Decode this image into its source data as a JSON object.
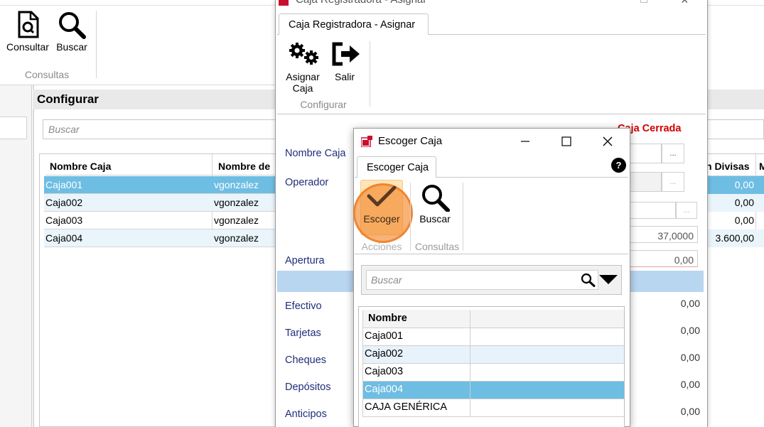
{
  "background_app": {
    "ribbon": {
      "buttons": [
        {
          "label": "Consultar",
          "icon": "document-search-icon"
        },
        {
          "label": "Buscar",
          "icon": "magnifier-icon"
        }
      ],
      "group_label": "Consultas"
    },
    "panel_title": "Configurar",
    "search_placeholder": "Buscar",
    "grid": {
      "columns": [
        "Nombre Caja",
        "Nombre de"
      ],
      "right_columns": [
        "n Divisas",
        "M"
      ],
      "rows": [
        {
          "name": "Caja001",
          "user": "vgonzalez",
          "divisas": "0,00"
        },
        {
          "name": "Caja002",
          "user": "vgonzalez",
          "divisas": "0,00"
        },
        {
          "name": "Caja003",
          "user": "vgonzalez",
          "divisas": "0,00"
        },
        {
          "name": "Caja004",
          "user": "vgonzalez",
          "divisas": "3.600,00"
        }
      ],
      "selected_index": 0
    }
  },
  "caja_window": {
    "title": "Caja Registradora -  Asignar",
    "tab_label": "Caja Registradora -  Asignar",
    "ribbon": {
      "buttons": [
        {
          "label_line1": "Asignar",
          "label_line2": "Caja",
          "icon": "gears-icon"
        },
        {
          "label": "Salir",
          "icon": "exit-icon"
        }
      ],
      "group_label": "Configurar"
    },
    "status": "Caja Cerrada",
    "status_color": "#d00000",
    "fields": {
      "nombre_caja": "Nombre Caja",
      "operador": "Operador",
      "apertura": "Apertura",
      "efectivo": "Efectivo",
      "tarjetas": "Tarjetas",
      "cheques": "Cheques",
      "depositos": "Depósitos",
      "anticipos": "Anticipos"
    },
    "dots_label": "...",
    "values": {
      "rate": "37,0000",
      "apertura": "0,00",
      "efectivo": "0,00",
      "tarjetas": "0,00",
      "cheques": "0,00",
      "depositos": "0,00",
      "anticipos": "0,00"
    }
  },
  "escoger_dialog": {
    "title": "Escoger Caja",
    "tab_label": "Escoger Caja",
    "help_label": "?",
    "ribbon": {
      "buttons": [
        {
          "label": "Escoger",
          "icon": "checkmark-icon"
        },
        {
          "label": "Buscar",
          "icon": "magnifier-icon"
        }
      ],
      "groups": [
        "Acciones",
        "Consultas"
      ]
    },
    "search_placeholder": "Buscar",
    "grid": {
      "column": "Nombre",
      "rows": [
        "Caja001",
        "Caja002",
        "Caja003",
        "Caja004",
        "CAJA GENÉRICA"
      ],
      "selected_index": 3
    }
  },
  "colors": {
    "selection": "#6ebde3",
    "field_label": "#1f2d7a",
    "highlight_button": "#ffe4b5",
    "click_indicator": "#f28930"
  }
}
